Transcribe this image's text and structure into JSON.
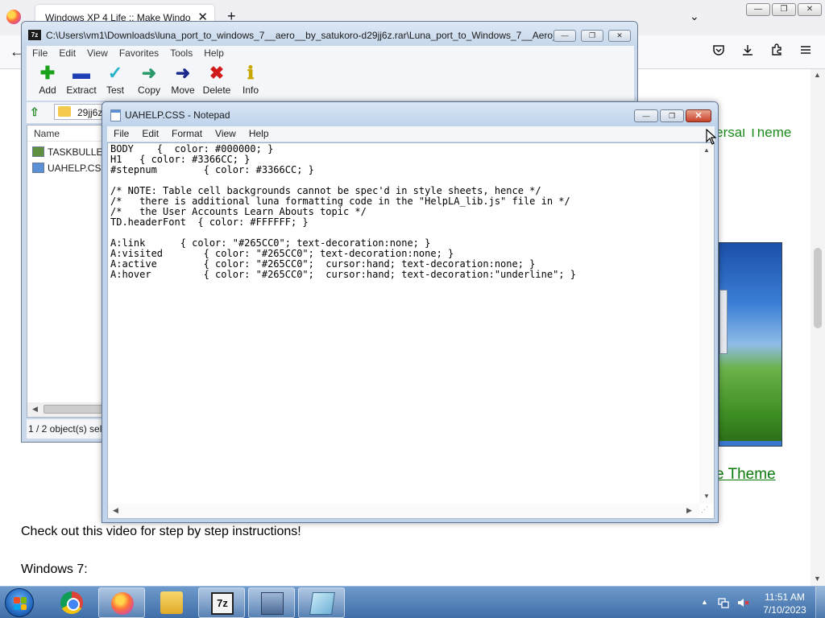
{
  "firefox": {
    "tab_title": "Windows XP 4 Life :: Make Window",
    "tab_close": "✕",
    "new_tab": "+",
    "list_tabs": "⌄",
    "win_min": "—",
    "win_restore": "❐",
    "win_close": "✕",
    "back": "←",
    "toolbar_icons": [
      "pocket-icon",
      "download-icon",
      "extensions-icon",
      "menu-icon"
    ],
    "page": {
      "top_link": "ting Universal Theme",
      "theme_link": "e Theme",
      "video_text": "Check out this video for step by step instructions!",
      "win7_text": "Windows 7:"
    }
  },
  "zip": {
    "title": "C:\\Users\\vm1\\Downloads\\luna_port_to_windows_7__aero__by_satukoro-d29jj6z.rar\\Luna_port_to_Windows_7__Aero__...",
    "app_icon": "7z",
    "menu": [
      "File",
      "Edit",
      "View",
      "Favorites",
      "Tools",
      "Help"
    ],
    "tools": [
      {
        "label": "Add",
        "icon": "✚",
        "color": "#1aa31a",
        "name": "add-icon"
      },
      {
        "label": "Extract",
        "icon": "▬",
        "color": "#1f3fb5",
        "name": "extract-icon"
      },
      {
        "label": "Test",
        "icon": "✓",
        "color": "#26b3c9",
        "name": "test-icon"
      },
      {
        "label": "Copy",
        "icon": "➜",
        "color": "#2a9a6a",
        "name": "copy-icon"
      },
      {
        "label": "Move",
        "icon": "➜",
        "color": "#1a2a8a",
        "name": "move-icon"
      },
      {
        "label": "Delete",
        "icon": "✖",
        "color": "#d11a1a",
        "name": "delete-icon"
      },
      {
        "label": "Info",
        "icon": "ℹ",
        "color": "#c8a800",
        "name": "info-icon"
      }
    ],
    "address": "29jj6z.r",
    "column_name": "Name",
    "files": [
      {
        "name": "TASKBULLET",
        "icon_color": "#5f8f3f"
      },
      {
        "name": "UAHELP.CSS",
        "icon_color": "#5b8fd6"
      }
    ],
    "status": "1 / 2 object(s) sel",
    "ctrl_min": "—",
    "ctrl_max": "❐",
    "ctrl_close": "✕"
  },
  "notepad": {
    "title": "UAHELP.CSS - Notepad",
    "menu": [
      "File",
      "Edit",
      "Format",
      "View",
      "Help"
    ],
    "ctrl_min": "—",
    "ctrl_max": "❐",
    "ctrl_close": "✕",
    "content": "BODY    {  color: #000000; }\nH1   { color: #3366CC; }\n#stepnum        { color: #3366CC; }\n\n/* NOTE: Table cell backgrounds cannot be spec'd in style sheets, hence */\n/*   there is additional luna formatting code in the \"HelpLA_lib.js\" file in */\n/*   the User Accounts Learn Abouts topic */\nTD.headerFont  { color: #FFFFFF; }\n\nA:link      { color: \"#265CC0\"; text-decoration:none; }\nA:visited       { color: \"#265CC0\"; text-decoration:none; }\nA:active        { color: \"#265CC0\";  cursor:hand; text-decoration:none; }\nA:hover         { color: \"#265CC0\";  cursor:hand; text-decoration:\"underline\"; }"
  },
  "taskbar": {
    "time": "11:51 AM",
    "date": "7/10/2023",
    "tray_arrow": "▲",
    "apps": [
      "chrome-icon",
      "firefox-icon",
      "file-explorer-icon",
      "7zip-icon",
      "setup-icon",
      "notepad-icon"
    ]
  }
}
